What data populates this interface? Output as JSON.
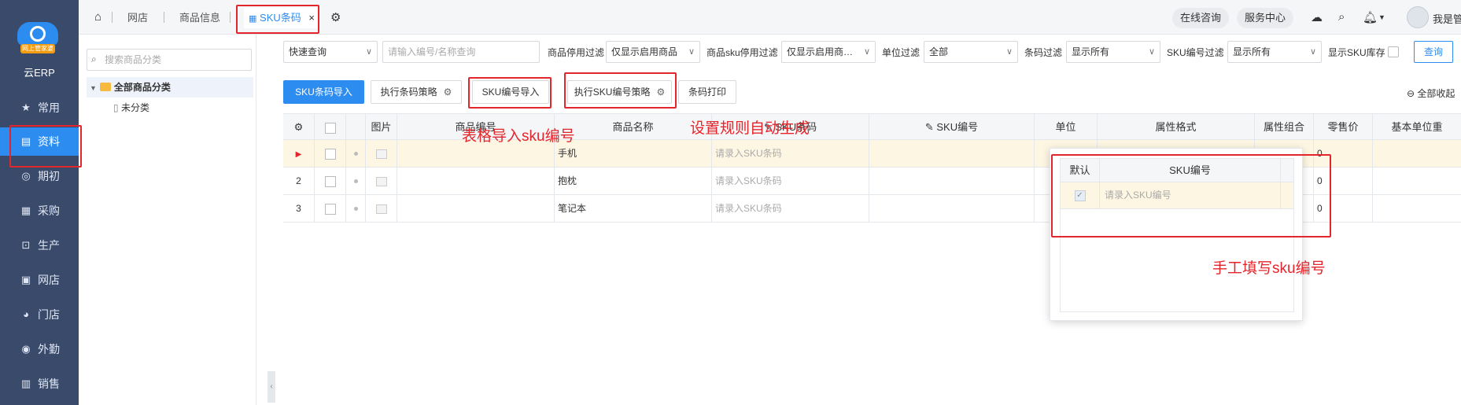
{
  "nav": {
    "logo_badge": "网上管家婆",
    "logo_text": "云ERP",
    "items": [
      {
        "label": "常用",
        "icon": "star-icon"
      },
      {
        "label": "资料",
        "icon": "document-icon"
      },
      {
        "label": "期初",
        "icon": "target-icon"
      },
      {
        "label": "采购",
        "icon": "purchase-icon"
      },
      {
        "label": "生产",
        "icon": "production-icon"
      },
      {
        "label": "网店",
        "icon": "shop-icon"
      },
      {
        "label": "门店",
        "icon": "store-icon"
      },
      {
        "label": "外勤",
        "icon": "field-icon"
      },
      {
        "label": "销售",
        "icon": "sales-icon"
      }
    ]
  },
  "tabs": {
    "home_icon": "home-icon",
    "items": [
      "网店",
      "商品信息"
    ],
    "active": "SKU条码",
    "close": "×"
  },
  "topbar": {
    "online_consult": "在线咨询",
    "service_center": "服务中心",
    "username": "我是管"
  },
  "category": {
    "search_placeholder": "搜索商品分类",
    "root": "全部商品分类",
    "child": "未分类"
  },
  "filters": {
    "quick_query": "快速查询",
    "search_placeholder": "请输入编号/名称查询",
    "goods_disable_label": "商品停用过滤",
    "goods_disable_value": "仅显示启用商品",
    "sku_disable_label": "商品sku停用过滤",
    "sku_disable_value": "仅显示启用商…",
    "unit_label": "单位过滤",
    "unit_value": "全部",
    "barcode_label": "条码过滤",
    "barcode_value": "显示所有",
    "skuno_label": "SKU编号过滤",
    "skuno_value": "显示所有",
    "show_stock_label": "显示SKU库存",
    "query": "查询"
  },
  "actions": {
    "import_barcode": "SKU条码导入",
    "exec_barcode_strategy": "执行条码策略",
    "import_skuno": "SKU编号导入",
    "exec_skuno_strategy": "执行SKU编号策略",
    "print_barcode": "条码打印",
    "collapse_all": "全部收起"
  },
  "grid": {
    "headers": {
      "image": "图片",
      "code": "商品编号",
      "name": "商品名称",
      "barcode": "SKU条码",
      "skuno": "SKU编号",
      "unit": "单位",
      "attr_format": "属性格式",
      "attr_combo": "属性组合",
      "retail_price": "零售价",
      "base_unit": "基本单位重"
    },
    "rows": [
      {
        "index": "",
        "name": "手机",
        "barcode_ph": "请录入SKU条码",
        "price": "0"
      },
      {
        "index": "2",
        "name": "抱枕",
        "barcode_ph": "请录入SKU条码",
        "price": "0"
      },
      {
        "index": "3",
        "name": "笔记本",
        "barcode_ph": "请录入SKU条码",
        "price": "0"
      }
    ]
  },
  "popup": {
    "col_default": "默认",
    "col_skuno": "SKU编号",
    "row_placeholder": "请录入SKU编号",
    "check_mark": "✓"
  },
  "annotations": {
    "table_import": "表格导入sku编号",
    "auto_rule": "设置规则自动生成",
    "manual": "手工填写sku编号"
  },
  "colors": {
    "accent": "#2d8cf0",
    "nav_bg": "#3a4a6b",
    "annotation_red": "#e3262b",
    "row_highlight": "#fdf6e3"
  }
}
